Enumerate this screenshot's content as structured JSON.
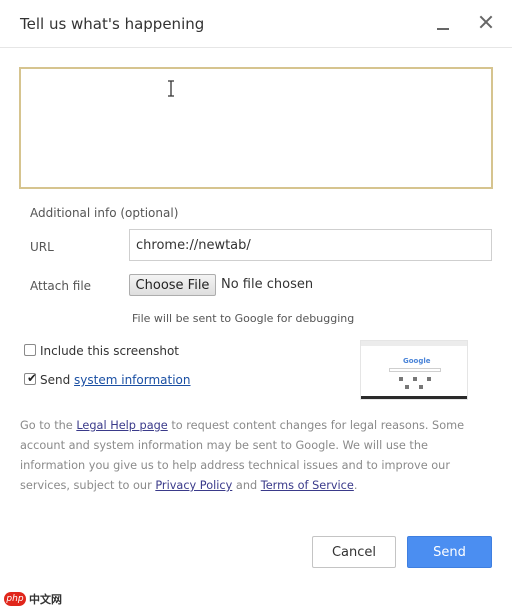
{
  "dialog": {
    "title": "Tell us what's happening",
    "minimize_icon": "minimize-icon",
    "close_icon": "close-icon"
  },
  "description": {
    "value": "",
    "cursor_icon": "text-cursor-icon"
  },
  "additional_info": {
    "heading": "Additional info (optional)",
    "url_label": "URL",
    "url_value": "chrome://newtab/",
    "attach_label": "Attach file",
    "choose_file_label": "Choose File",
    "no_file_text": "No file chosen",
    "attach_note": "File will be sent to Google for debugging"
  },
  "options": {
    "include_screenshot_label": "Include this screenshot",
    "include_screenshot_checked": false,
    "send_prefix": "Send ",
    "system_information_link": "system information",
    "send_system_info_checked": true,
    "thumbnail_logo": "Google"
  },
  "legal": {
    "part1": "Go to the ",
    "legal_help_link": "Legal Help page",
    "part2": " to request content changes for legal reasons. Some account and system information may be sent to Google. We will use the information you give us to help address technical issues and to improve our services, subject to our ",
    "privacy_policy_link": "Privacy Policy",
    "part3": " and ",
    "terms_link": "Terms of Service",
    "part4": "."
  },
  "buttons": {
    "cancel_label": "Cancel",
    "send_label": "Send"
  },
  "watermark": {
    "logo_text": "php",
    "site_text": "中文网"
  },
  "colors": {
    "send_button": "#4b8ef1",
    "description_border": "#d6c48f",
    "link": "#1a4fa3"
  }
}
